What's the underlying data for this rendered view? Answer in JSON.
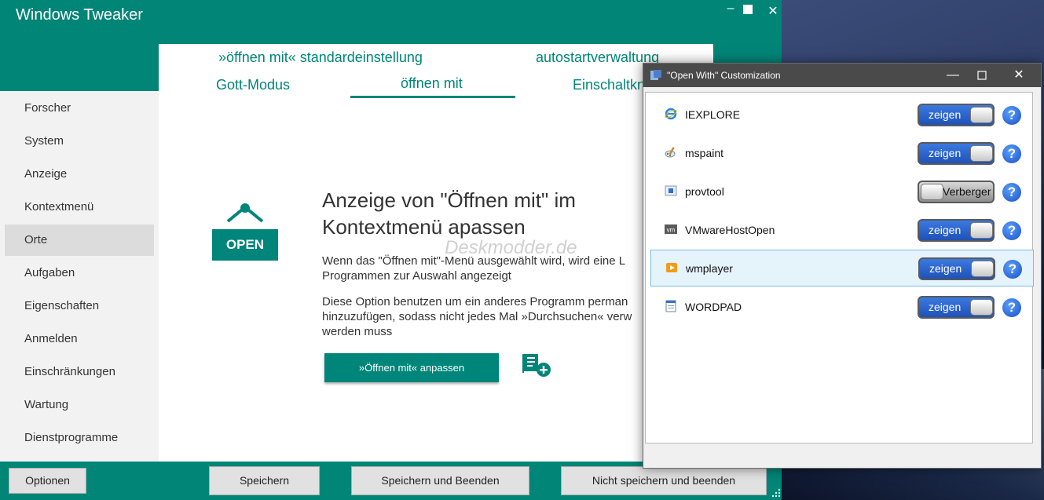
{
  "main_window": {
    "title": "Windows Tweaker",
    "controls": {
      "minimize": "–",
      "close": "✕"
    }
  },
  "tabs": {
    "row1": [
      "»öffnen mit« standardeinstellung",
      "autostartverwaltung"
    ],
    "row2": [
      "Gott-Modus",
      "öffnen mit",
      "Einschaltkn"
    ],
    "active": "öffnen mit"
  },
  "sidebar": {
    "items": [
      "Forscher",
      "System",
      "Anzeige",
      "Kontextmenü",
      "Orte",
      "Aufgaben",
      "Eigenschaften",
      "Anmelden",
      "Einschränkungen",
      "Wartung",
      "Dienstprogramme"
    ],
    "active": "Orte"
  },
  "content": {
    "sign_label": "OPEN",
    "heading_line1": "Anzeige von \"Öffnen mit\" im",
    "heading_line2": "Kontextmenü apassen",
    "desc1_line1": "Wenn das \"Öffnen mit\"-Menü ausgewählt wird, wird eine L",
    "desc1_line2": "Programmen zur Auswahl angezeigt",
    "desc2_line1": "Diese Option benutzen um ein anderes Programm perman",
    "desc2_line2": "hinzuzufügen, sodass nicht jedes Mal »Durchsuchen« verw",
    "desc2_line3": "werden muss",
    "customize_button": "»Öffnen mit« anpassen",
    "watermark": "Deskmodder.de"
  },
  "bottom_bar": {
    "options": "Optionen",
    "save": "Speichern",
    "save_exit": "Speichern und Beenden",
    "discard_exit": "Nicht speichern und beenden"
  },
  "dialog": {
    "title": "\"Open With\" Customization",
    "controls": {
      "minimize": "—",
      "close": "✕"
    },
    "rows": [
      {
        "label": "IEXPLORE",
        "state": "zeigen",
        "on": true
      },
      {
        "label": "mspaint",
        "state": "zeigen",
        "on": true
      },
      {
        "label": "provtool",
        "state": "Verberger",
        "on": false
      },
      {
        "label": "VMwareHostOpen",
        "state": "zeigen",
        "on": true
      },
      {
        "label": "wmplayer",
        "state": "zeigen",
        "on": true,
        "selected": true
      },
      {
        "label": "WORDPAD",
        "state": "zeigen",
        "on": true
      }
    ],
    "help_glyph": "?",
    "vm_icon_text": "vm"
  },
  "colors": {
    "accent": "#008577",
    "toggle_on": "#2a62cc",
    "help": "#1b4fc4"
  }
}
